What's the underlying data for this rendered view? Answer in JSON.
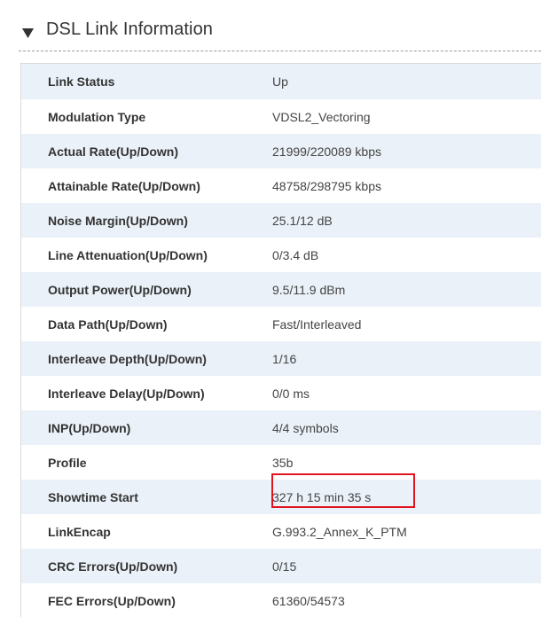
{
  "section": {
    "title": "DSL Link Information",
    "icon": "triangle-down-icon"
  },
  "rows": [
    {
      "label": "Link Status",
      "value": "Up"
    },
    {
      "label": "Modulation Type",
      "value": "VDSL2_Vectoring"
    },
    {
      "label": "Actual Rate(Up/Down)",
      "value": "21999/220089 kbps"
    },
    {
      "label": "Attainable Rate(Up/Down)",
      "value": "48758/298795 kbps"
    },
    {
      "label": "Noise Margin(Up/Down)",
      "value": "25.1/12 dB"
    },
    {
      "label": "Line Attenuation(Up/Down)",
      "value": "0/3.4 dB"
    },
    {
      "label": "Output Power(Up/Down)",
      "value": "9.5/11.9 dBm"
    },
    {
      "label": "Data Path(Up/Down)",
      "value": "Fast/Interleaved"
    },
    {
      "label": "Interleave Depth(Up/Down)",
      "value": "1/16"
    },
    {
      "label": "Interleave Delay(Up/Down)",
      "value": "0/0 ms"
    },
    {
      "label": "INP(Up/Down)",
      "value": "4/4 symbols"
    },
    {
      "label": "Profile",
      "value": "35b"
    },
    {
      "label": "Showtime Start",
      "value": "327 h 15 min 35 s"
    },
    {
      "label": "LinkEncap",
      "value": "G.993.2_Annex_K_PTM"
    },
    {
      "label": "CRC Errors(Up/Down)",
      "value": "0/15"
    },
    {
      "label": "FEC Errors(Up/Down)",
      "value": "61360/54573"
    }
  ],
  "colors": {
    "row_stripe": "#eaf1f8",
    "highlight": "#e0141f"
  }
}
